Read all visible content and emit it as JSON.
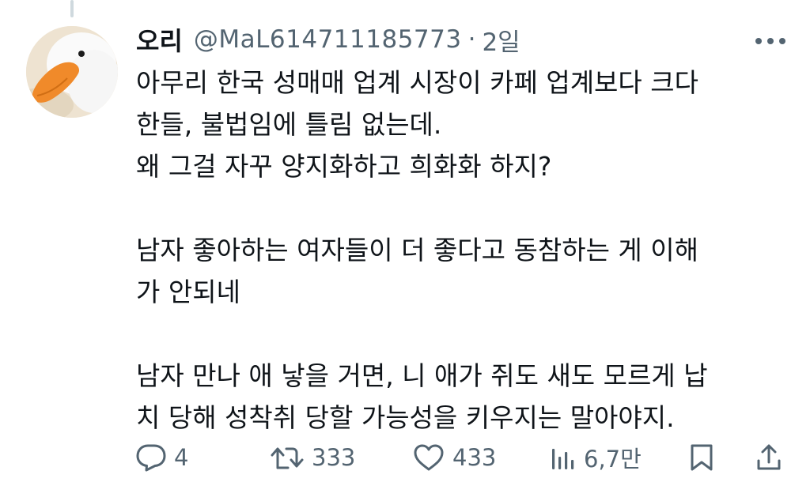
{
  "tweet": {
    "author": {
      "display_name": "오리",
      "handle": "@MaL614711185773",
      "separator": "·",
      "time": "2일"
    },
    "text_lines": [
      "아무리 한국 성매매 업계 시장이 카페 업계보다 크다",
      "한들, 불법임에 틀림 없는데.",
      "왜 그걸 자꾸 양지화하고 희화화 하지?",
      "",
      "남자 좋아하는 여자들이 더 좋다고 동참하는 게 이해",
      "가 안되네",
      "",
      "남자 만나 애 낳을 거면, 니 애가 쥐도 새도 모르게 납",
      "치 당해 성착취 당할 가능성을 키우지는 말아야지."
    ],
    "actions": {
      "reply_count": "4",
      "retweet_count": "333",
      "like_count": "433",
      "views_count": "6,7만"
    },
    "icons": {
      "reply": "reply-icon",
      "retweet": "retweet-icon",
      "like": "heart-icon",
      "views": "views-icon",
      "bookmark": "bookmark-icon",
      "share": "share-icon",
      "more": "more-icon"
    },
    "colors": {
      "text": "#0f1419",
      "secondary": "#536471",
      "thread_line": "#cfd9de"
    }
  }
}
